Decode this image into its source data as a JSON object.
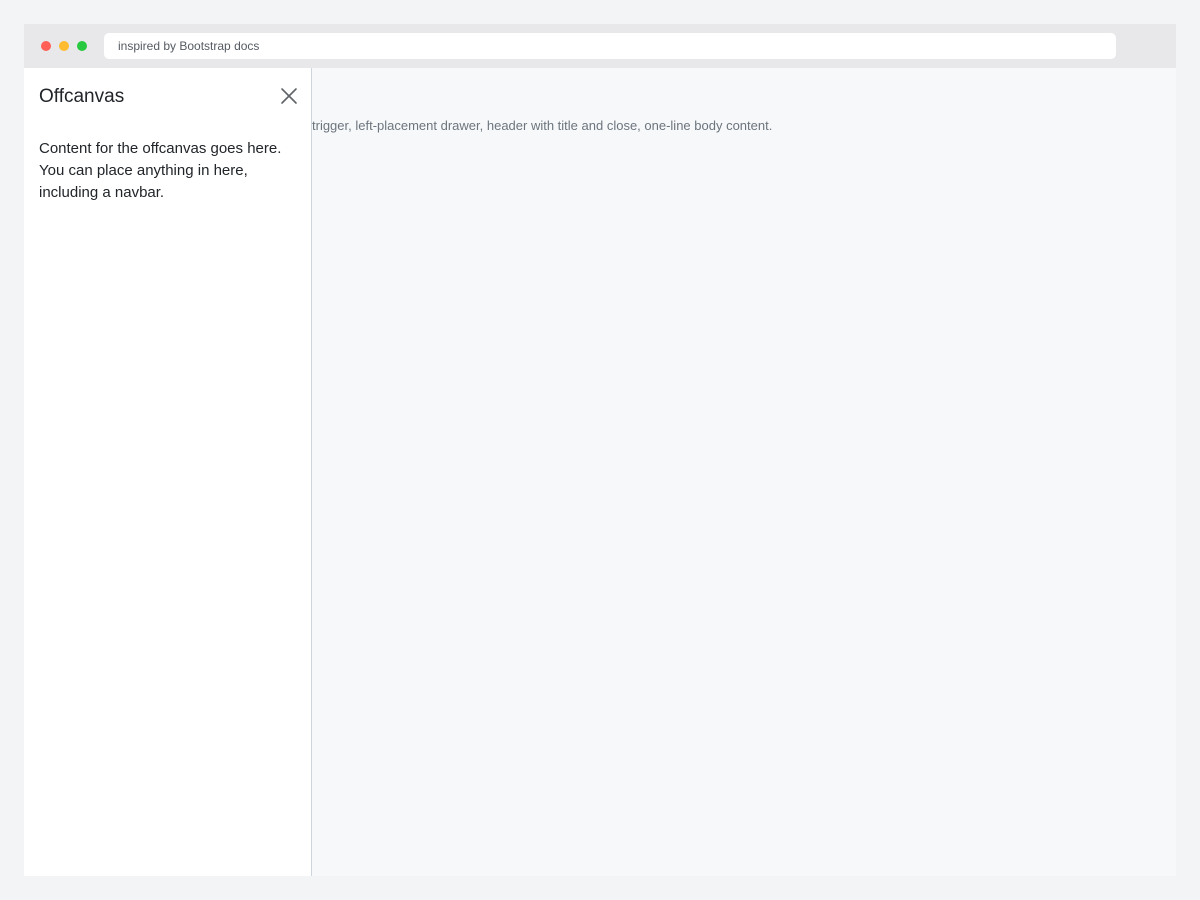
{
  "browser": {
    "address": "inspired by Bootstrap docs",
    "traffic_lights": {
      "close_color": "#ff5f57",
      "minimize_color": "#febc2e",
      "maximize_color": "#28c840"
    }
  },
  "page": {
    "description": "trigger, left-placement drawer, header with title and close, one-line body content."
  },
  "offcanvas": {
    "placement": "left",
    "title": "Offcanvas",
    "close_icon": "close-icon",
    "body_text": "Content for the offcanvas goes here. You can place anything in here, including a navbar."
  },
  "colors": {
    "drawer_background": "#ffffff",
    "page_background": "#f7f8fa",
    "text": "#212529",
    "muted_text": "#6c757d",
    "drawer_border": "#cfd5dc"
  }
}
